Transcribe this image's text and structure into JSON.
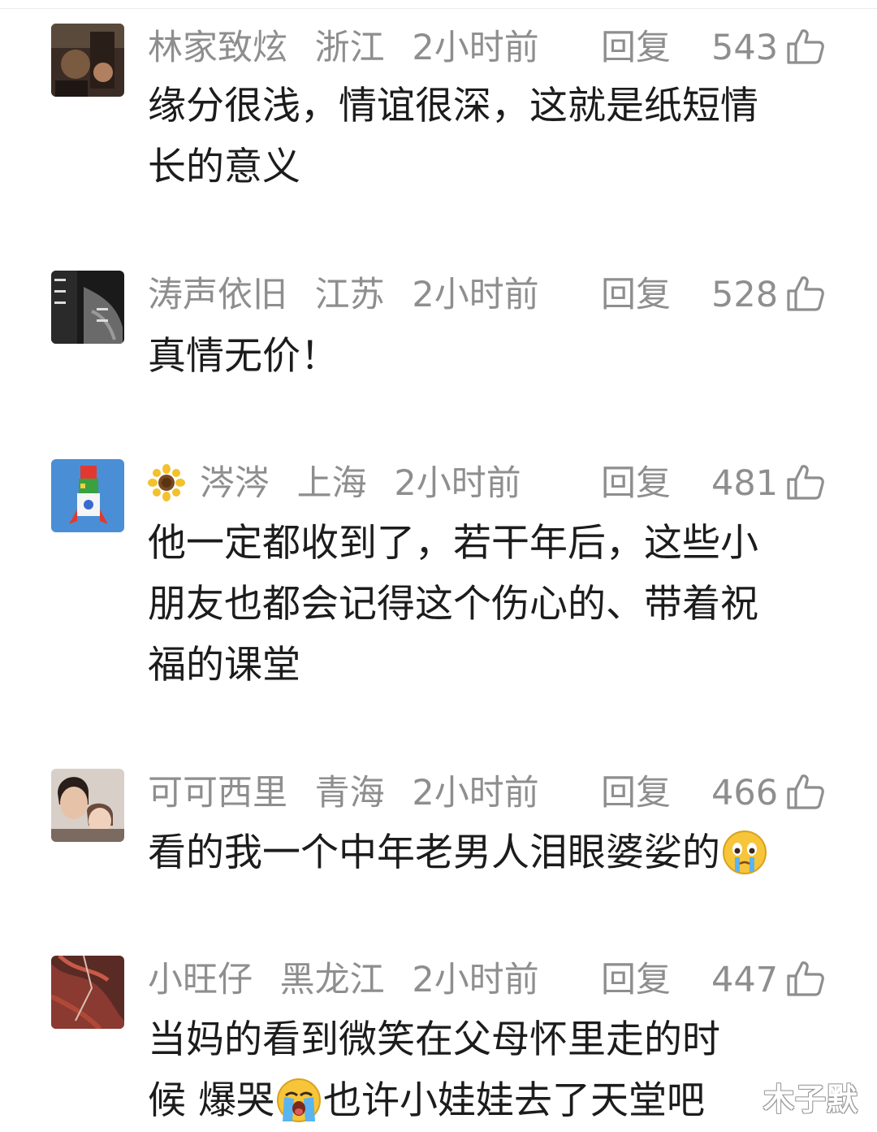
{
  "comments": [
    {
      "username": "林家致炫",
      "location": "浙江",
      "time": "2小时前",
      "reply_label": "回复",
      "likes": "543",
      "lines": [
        "缘分很浅，情谊很深，这就是纸短情",
        "长的意义"
      ]
    },
    {
      "username": "涛声依旧",
      "location": "江苏",
      "time": "2小时前",
      "reply_label": "回复",
      "likes": "528",
      "lines": [
        "真情无价！"
      ]
    },
    {
      "username": "涔涔",
      "location": "上海",
      "time": "2小时前",
      "reply_label": "回复",
      "likes": "481",
      "lines": [
        "他一定都收到了，若干年后，这些小",
        "朋友也都会记得这个伤心的、带着祝",
        "福的课堂"
      ]
    },
    {
      "username": "可可西里",
      "location": "青海",
      "time": "2小时前",
      "reply_label": "回复",
      "likes": "466",
      "lines": [
        "看的我一个中年老男人泪眼婆娑的"
      ]
    },
    {
      "username": "小旺仔",
      "location": "黑龙江",
      "time": "2小时前",
      "reply_label": "回复",
      "likes": "447",
      "lines": [
        "当妈的看到微笑在父母怀里走的时",
        "候 爆哭",
        "也许小娃娃去了天堂吧"
      ]
    }
  ],
  "watermark": "木子默"
}
